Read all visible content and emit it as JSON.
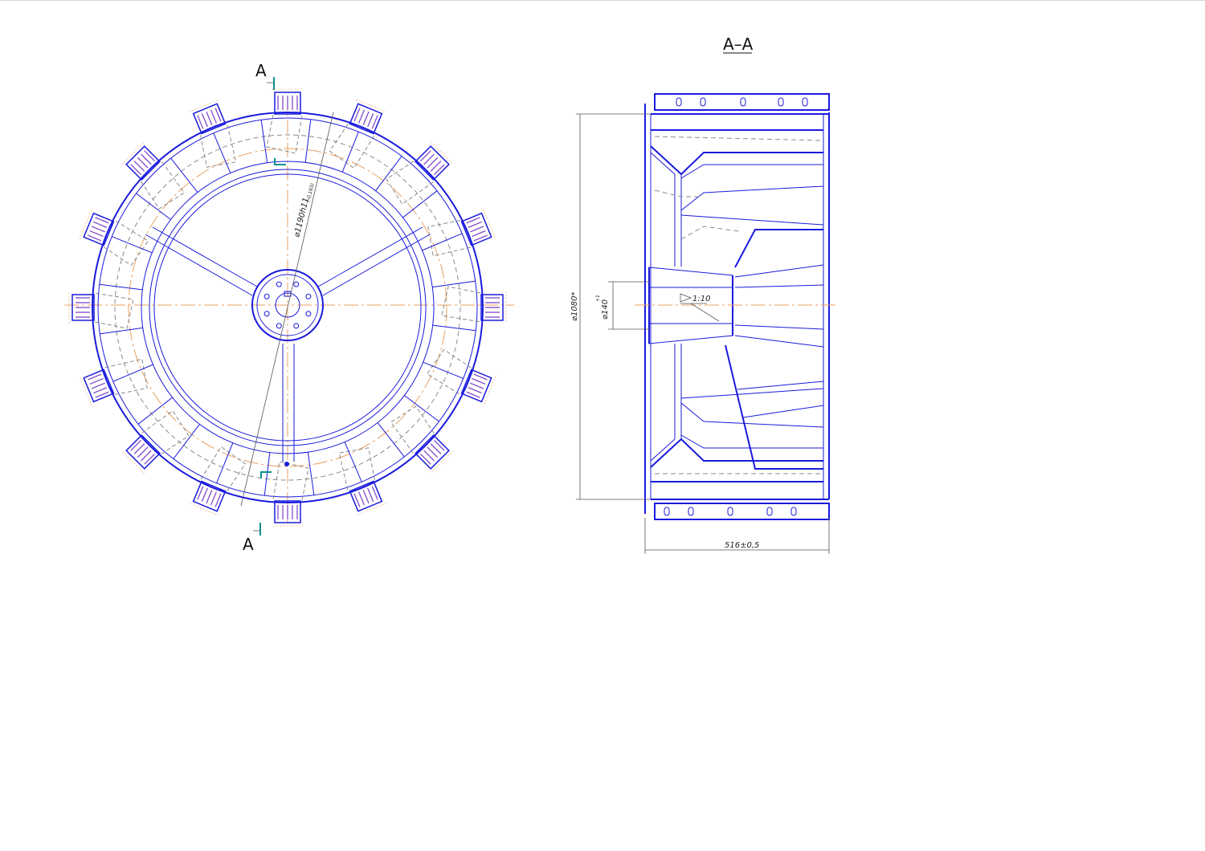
{
  "drawing": {
    "section_title": "A–A",
    "section_mark_top": "A",
    "section_mark_bottom": "A",
    "dim_diameter_outer": "⌀1190h11",
    "dim_diameter_outer_tol": "(-0,165)",
    "dim_diameter_1080": "⌀1080*",
    "dim_bore": "⌀140",
    "dim_bore_tol": "+1",
    "taper": "1:10",
    "dim_width": "516±0,5"
  },
  "colors": {
    "outline": "#1a1adc",
    "hidden": "#8a8a8a",
    "axis": "#e8a060",
    "section_marker": "#0b8f8f"
  }
}
